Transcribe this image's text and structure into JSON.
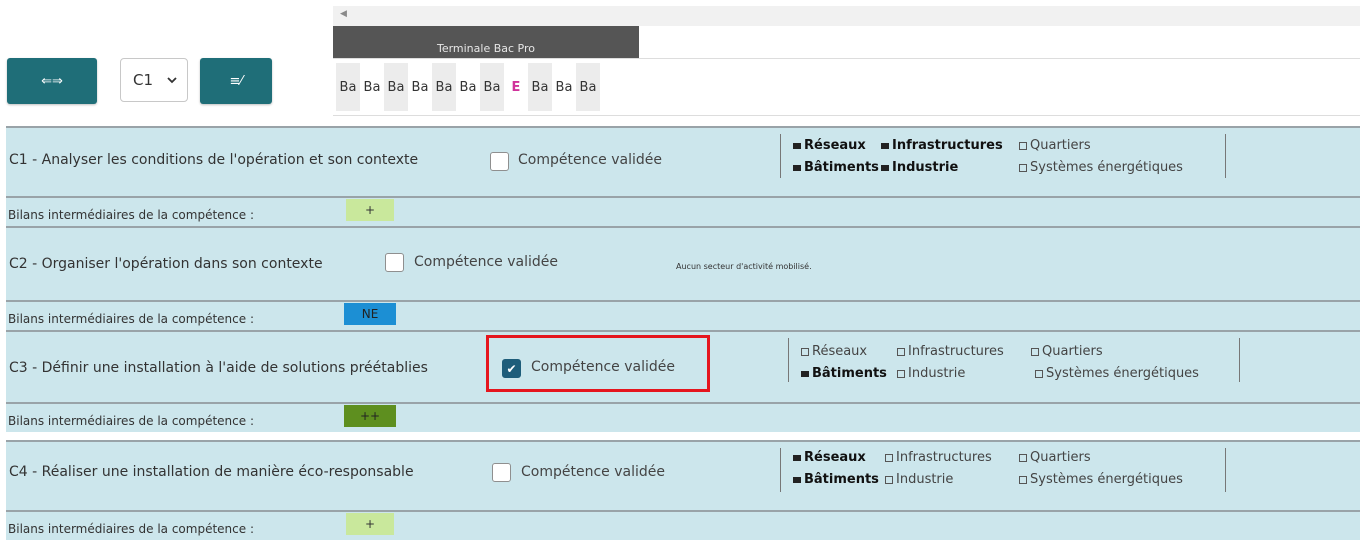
{
  "toolbar": {
    "swap_button_label": "⇐⇒",
    "selected_competence": "C1",
    "apply_button_label": "≡⁄"
  },
  "period": {
    "title": "Terminale Bac Pro",
    "evaluations": [
      "Ba",
      "Ba",
      "Ba",
      "Ba",
      "Ba",
      "Ba",
      "Ba",
      "E",
      "Ba",
      "Ba",
      "Ba"
    ]
  },
  "competences": [
    {
      "title": "C1 - Analyser les conditions de l'opération et son contexte",
      "validated_label": "Compétence validée",
      "validated": false,
      "sectors": [
        {
          "name": "Réseaux",
          "active": true
        },
        {
          "name": "Infrastructures",
          "active": true
        },
        {
          "name": "Quartiers",
          "active": false
        },
        {
          "name": "Bâtiments",
          "active": true
        },
        {
          "name": "Industrie",
          "active": true
        },
        {
          "name": "Systèmes énergétiques",
          "active": false
        }
      ],
      "bilan_label": "Bilans intermédiaires de la compétence :",
      "bilan_value": "+",
      "bilan_color": "#c9e89c"
    },
    {
      "title": "C2 - Organiser l'opération dans son contexte",
      "validated_label": "Compétence validée",
      "validated": false,
      "no_sector_text": "Aucun secteur d'activité mobilisé.",
      "bilan_label": "Bilans intermédiaires de la compétence :",
      "bilan_value": "NE",
      "bilan_color": "#1c8fd4"
    },
    {
      "title": "C3 - Définir une installation à l'aide de solutions préétablies",
      "validated_label": "Compétence validée",
      "validated": true,
      "sectors": [
        {
          "name": "Réseaux",
          "active": false
        },
        {
          "name": "Infrastructures",
          "active": false
        },
        {
          "name": "Quartiers",
          "active": false
        },
        {
          "name": "Bâtiments",
          "active": true
        },
        {
          "name": "Industrie",
          "active": false
        },
        {
          "name": "Systèmes énergétiques",
          "active": false
        }
      ],
      "bilan_label": "Bilans intermédiaires de la compétence :",
      "bilan_value": "++",
      "bilan_color": "#5e8f1f"
    },
    {
      "title": "C4 - Réaliser une installation de manière éco-responsable",
      "validated_label": "Compétence validée",
      "validated": false,
      "sectors": [
        {
          "name": "Réseaux",
          "active": true
        },
        {
          "name": "Infrastructures",
          "active": false
        },
        {
          "name": "Quartiers",
          "active": false
        },
        {
          "name": "Bâtiments",
          "active": true
        },
        {
          "name": "Industrie",
          "active": false
        },
        {
          "name": "Systèmes énergétiques",
          "active": false
        }
      ],
      "bilan_label": "Bilans intermédiaires de la compétence :",
      "bilan_value": "+",
      "bilan_color": "#c9e89c"
    }
  ]
}
